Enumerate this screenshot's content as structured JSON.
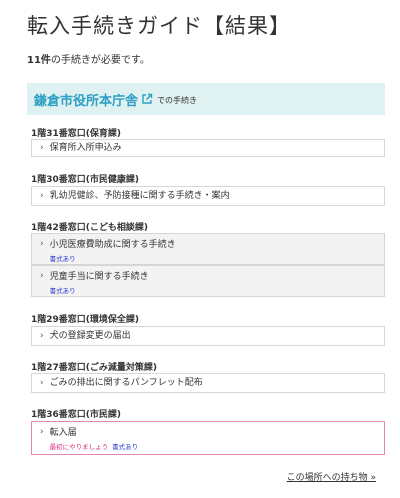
{
  "page": {
    "title": "転入手続きガイド【結果】",
    "summary_count": "11件",
    "summary_suffix": "の手続きが必要です。"
  },
  "office": {
    "name": "鎌倉市役所本庁舎",
    "suffix": "での手続き"
  },
  "sections": [
    {
      "heading": "1階31番窓口(保育課)",
      "items": [
        {
          "text": "保育所入所申込み"
        }
      ]
    },
    {
      "heading": "1階30番窓口(市民健康課)",
      "items": [
        {
          "text": "乳幼児健診、予防接種に関する手続き・案内"
        }
      ]
    },
    {
      "heading": "1階42番窓口(こども相談課)",
      "items": [
        {
          "text": "小児医療費助成に関する手続き",
          "badge": "書式あり"
        },
        {
          "text": "児童手当に関する手続き",
          "badge": "書式あり"
        }
      ]
    },
    {
      "heading": "1階29番窓口(環境保全課)",
      "items": [
        {
          "text": "犬の登録変更の届出"
        }
      ]
    },
    {
      "heading": "1階27番窓口(ごみ減量対策課)",
      "items": [
        {
          "text": "ごみの排出に関するパンフレット配布"
        }
      ]
    },
    {
      "heading": "1階36番窓口(市民課)",
      "items": [
        {
          "text": "転入届",
          "first": "最初にやりましょう",
          "badge": "書式あり"
        }
      ]
    }
  ],
  "bottom_link": "この場所への持ち物 »",
  "colors": {
    "office_bg": "#dff1f1",
    "office_link": "#2d9fc4",
    "badge_form": "#2a3fd0",
    "badge_first": "#e0307a",
    "highlight_border": "#e486b3"
  }
}
